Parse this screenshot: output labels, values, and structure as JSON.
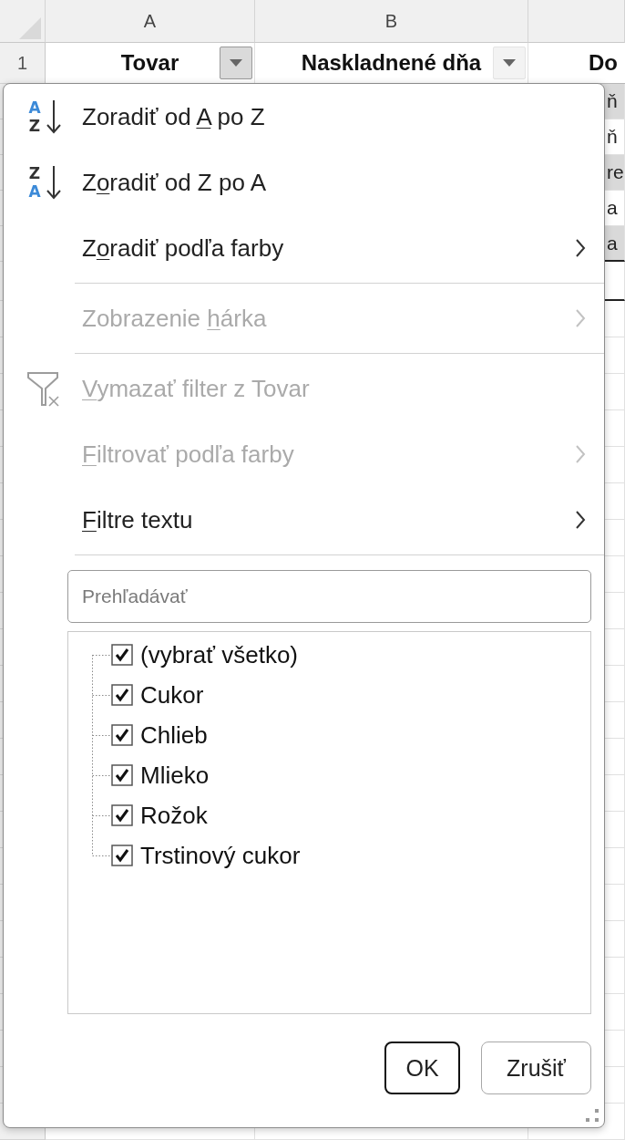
{
  "sheet": {
    "column_headers": [
      "A",
      "B"
    ],
    "header_row": {
      "row_number": "1",
      "cells": [
        {
          "text": "Tovar",
          "filter_open": true
        },
        {
          "text": "Naskladnené dňa",
          "filter_open": false
        },
        {
          "text": "Do"
        }
      ]
    },
    "column_3_cells": [
      {
        "text": "ň",
        "shaded": true
      },
      {
        "text": "ň",
        "shaded": false
      },
      {
        "text": "re",
        "shaded": true
      },
      {
        "text": "a",
        "shaded": false
      },
      {
        "text": "a",
        "shaded": true
      }
    ]
  },
  "filter_menu": {
    "groups": [
      {
        "items": [
          {
            "kind": "ascending",
            "icon_letters": [
              "A",
              "Z"
            ],
            "label_start": "Zoradiť od ",
            "access_key": "A",
            "label_end": " po Z",
            "disabled": false
          },
          {
            "kind": "descending",
            "icon_letters": [
              "Z",
              "A"
            ],
            "label_start": "Z",
            "access_key": "o",
            "label_end": "radiť od Z po A",
            "disabled": false
          },
          {
            "kind": "submenu",
            "label_start": "Z",
            "access_key": "o",
            "label_end": "radiť podľa farby",
            "disabled": false
          }
        ]
      },
      {
        "items": [
          {
            "kind": "submenu",
            "label_start": "Zobrazenie ",
            "access_key": "h",
            "label_end": "árka",
            "disabled": true
          }
        ]
      },
      {
        "items": [
          {
            "kind": "clear",
            "access_key": "V",
            "label_end": "ymazať filter z Tovar",
            "disabled": true
          },
          {
            "kind": "submenu",
            "access_key": "F",
            "label_end": "iltrovať podľa farby",
            "disabled": true
          },
          {
            "kind": "submenu",
            "access_key": "F",
            "label_end": "iltre textu",
            "disabled": false
          }
        ]
      }
    ],
    "search": {
      "placeholder": "Prehľadávať"
    },
    "values": [
      {
        "label": "(vybrať všetko)",
        "checked": true
      },
      {
        "label": "Cukor",
        "checked": true
      },
      {
        "label": "Chlieb",
        "checked": true
      },
      {
        "label": "Mlieko",
        "checked": true
      },
      {
        "label": "Rožok",
        "checked": true
      },
      {
        "label": "Trstinový cukor",
        "checked": true
      }
    ],
    "buttons": [
      {
        "label": "OK",
        "default": true
      },
      {
        "label": "Zrušiť",
        "default": false
      }
    ]
  }
}
